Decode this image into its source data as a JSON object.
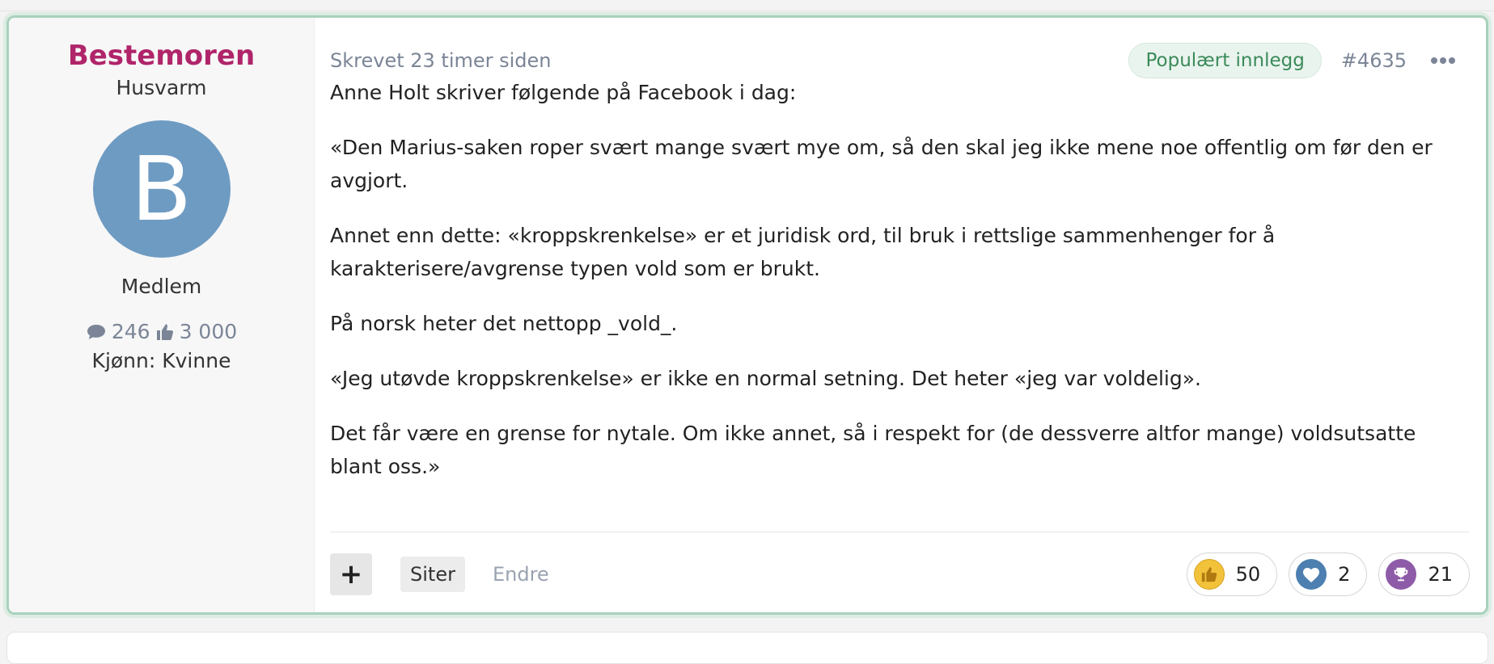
{
  "user": {
    "name": "Bestemoren",
    "title": "Husvarm",
    "avatar_letter": "B",
    "avatar_color": "#6e9bc2",
    "role": "Medlem",
    "posts_count": "246",
    "likes_count": "3 000",
    "gender": "Kjønn: Kvinne"
  },
  "post": {
    "time": "Skrevet 23 timer siden",
    "badge": "Populært innlegg",
    "number": "#4635",
    "paragraphs": [
      "Anne Holt skriver følgende på Facebook i dag:",
      "«Den Marius-saken roper svært mange svært mye om, så den skal jeg ikke mene noe offentlig om før den er avgjort.",
      "Annet enn dette: «kroppskrenkelse» er et juridisk ord, til bruk i rettslige sammenhenger for å karakterisere/avgrense typen vold som er brukt.",
      "På norsk heter det nettopp _vold_.",
      "«Jeg utøvde kroppskrenkelse» er ikke en normal setning. Det heter «jeg var voldelig».",
      "Det får være en grense for nytale. Om ikke annet, så i respekt for (de dessverre altfor mange) voldsutsatte blant oss.»"
    ]
  },
  "footer": {
    "plus_label": "+",
    "quote_label": "Siter",
    "edit_label": "Endre"
  },
  "reactions": [
    {
      "icon": "thumbs-up-icon",
      "count": "50"
    },
    {
      "icon": "heart-icon",
      "count": "2"
    },
    {
      "icon": "trophy-icon",
      "count": "21"
    }
  ],
  "colors": {
    "username": "#b0256a",
    "badge_text": "#3a8a5a",
    "post_border": "#a9d1bc"
  }
}
